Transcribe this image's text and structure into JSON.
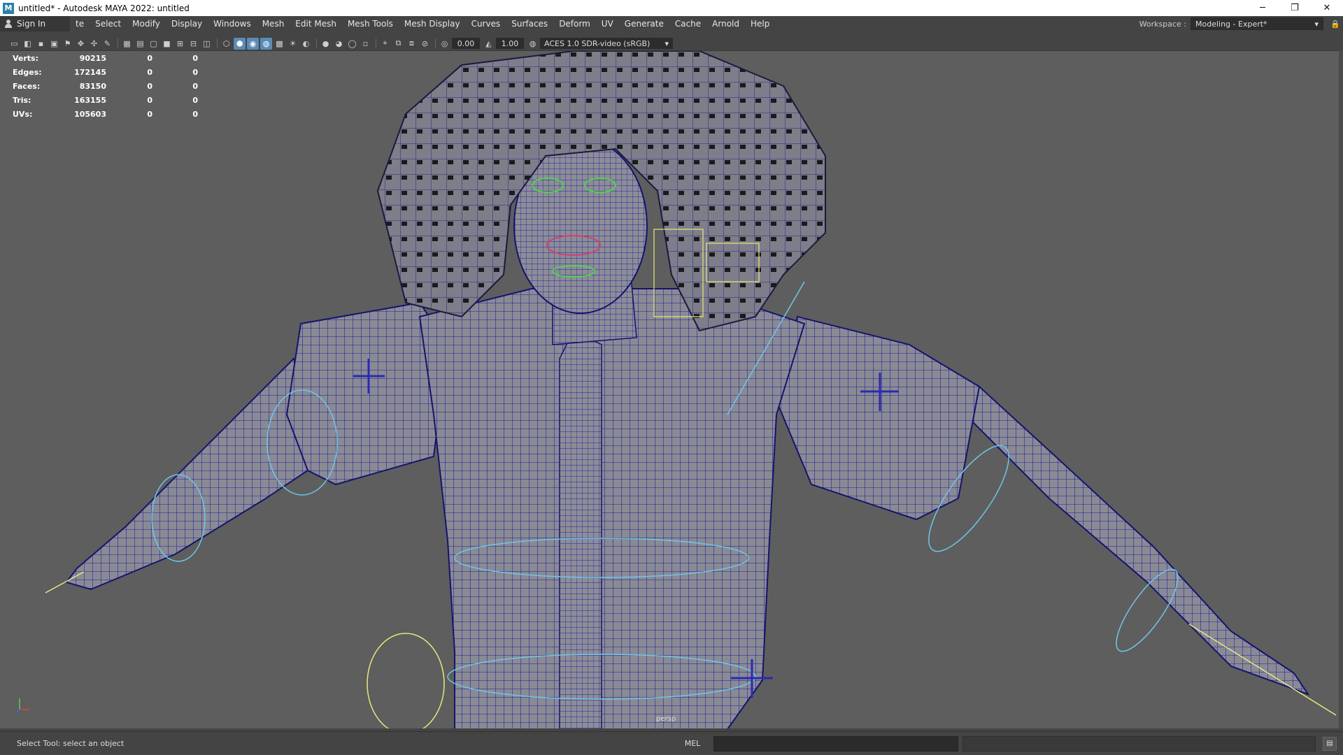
{
  "window": {
    "title": "untitled* - Autodesk MAYA 2022: untitled",
    "app_icon": "M",
    "minimize": "─",
    "restore": "❐",
    "close": "✕"
  },
  "menubar": {
    "sign_in": "Sign In",
    "items": [
      "te",
      "Select",
      "Modify",
      "Display",
      "Windows",
      "Mesh",
      "Edit Mesh",
      "Mesh Tools",
      "Mesh Display",
      "Curves",
      "Surfaces",
      "Deform",
      "UV",
      "Generate",
      "Cache",
      "Arnold",
      "Help"
    ],
    "workspace_label": "Workspace :",
    "workspace_value": "Modeling - Expert*"
  },
  "toolbar": {
    "exposure_value": "0.00",
    "gamma_value": "1.00",
    "color_space": "ACES 1.0 SDR-video (sRGB)"
  },
  "hud": {
    "rows": [
      {
        "label": "Verts:",
        "v1": "90215",
        "v2": "0",
        "v3": "0"
      },
      {
        "label": "Edges:",
        "v1": "172145",
        "v2": "0",
        "v3": "0"
      },
      {
        "label": "Faces:",
        "v1": "83150",
        "v2": "0",
        "v3": "0"
      },
      {
        "label": "Tris:",
        "v1": "163155",
        "v2": "0",
        "v3": "0"
      },
      {
        "label": "UVs:",
        "v1": "105603",
        "v2": "0",
        "v3": "0"
      }
    ],
    "camera": "persp"
  },
  "statusbar": {
    "help_line": "Select Tool: select an object",
    "mel_label": "MEL"
  },
  "colors": {
    "viewport_bg": "#5e5e5e",
    "wire": "#1d1d9c",
    "mesh_fill": "#8a8a94",
    "curve_cyan": "#6fc6e8",
    "curve_yellow": "#e8e87a",
    "curve_green": "#4fd24f"
  }
}
